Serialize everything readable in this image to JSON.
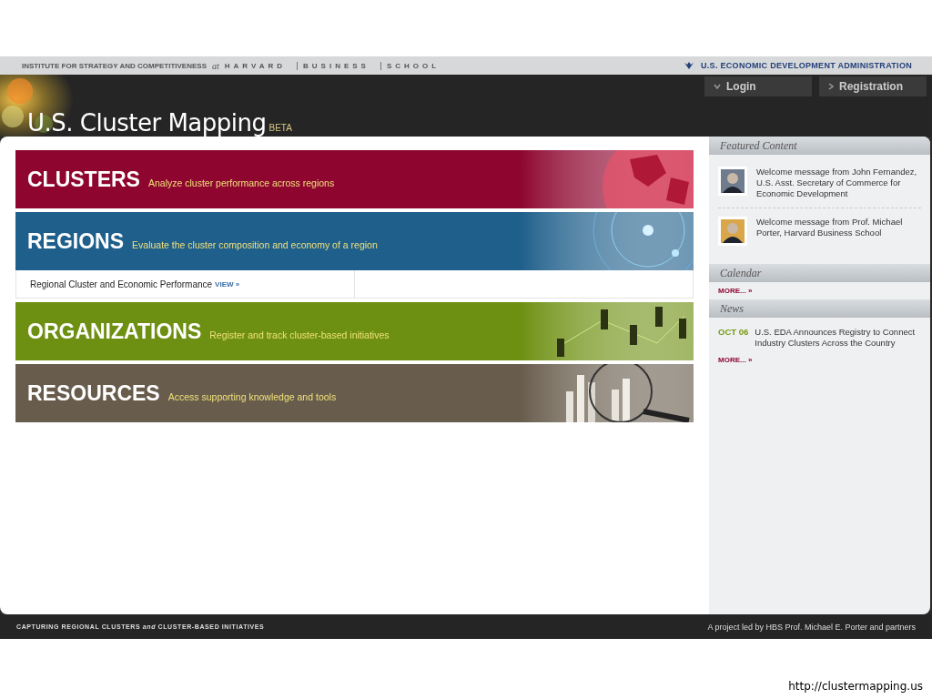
{
  "top_bar": {
    "institute": "INSTITUTE FOR STRATEGY AND COMPETITIVENESS",
    "connector": "at",
    "school_words": [
      "HARVARD",
      "BUSINESS",
      "SCHOOL"
    ],
    "partner": "U.S. ECONOMIC DEVELOPMENT ADMINISTRATION"
  },
  "header": {
    "title": "U.S. Cluster Mapping",
    "badge": "BETA",
    "buttons": [
      {
        "label": "Login",
        "kind": "dropdown"
      },
      {
        "label": "Registration",
        "kind": "link"
      }
    ]
  },
  "sections": [
    {
      "title": "CLUSTERS",
      "tagline": "Analyze cluster performance across regions",
      "color": "#8e0630"
    },
    {
      "title": "REGIONS",
      "tagline": "Evaluate the cluster composition and economy of a region",
      "color": "#1f5f8b",
      "links": [
        {
          "text": "Regional Cluster and Economic Performance",
          "action": "VIEW »"
        }
      ]
    },
    {
      "title": "ORGANIZATIONS",
      "tagline": "Register and track cluster-based initiatives",
      "color": "#6e9012"
    },
    {
      "title": "RESOURCES",
      "tagline": "Access supporting knowledge and tools",
      "color": "#685c4c"
    }
  ],
  "sidebar": {
    "featured": {
      "heading": "Featured Content",
      "items": [
        {
          "text": "Welcome message from John Fernandez, U.S. Asst. Secretary of Commerce for Economic Development"
        },
        {
          "text": "Welcome message from Prof. Michael Porter, Harvard Business School"
        }
      ]
    },
    "calendar": {
      "heading": "Calendar",
      "more": "MORE... »"
    },
    "news": {
      "heading": "News",
      "items": [
        {
          "date": "OCT 06",
          "text": "U.S. EDA Announces Registry to Connect Industry Clusters Across the Country"
        }
      ],
      "more": "MORE... »"
    }
  },
  "footer": {
    "tagline": "CAPTURING REGIONAL CLUSTERS *and* CLUSTER-BASED INITIATIVES",
    "credit": "A project led by HBS Prof. Michael E. Porter and partners"
  },
  "caption": "http://clustermapping.us"
}
